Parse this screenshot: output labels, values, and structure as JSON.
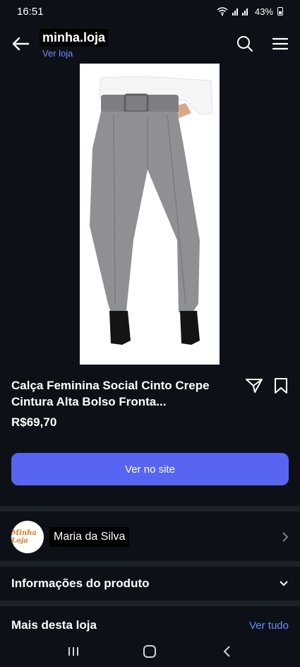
{
  "status": {
    "time": "16:51",
    "battery": "43%"
  },
  "header": {
    "store_name": "minha.loja",
    "store_link": "Ver loja"
  },
  "product": {
    "title": "Calça Feminina Social Cinto Crepe Cintura Alta Bolso Fronta...",
    "price": "R$69,70",
    "cta": "Ver no site"
  },
  "seller": {
    "logo_text": "Minha Loja",
    "name": "Maria da Silva"
  },
  "sections": {
    "product_info": "Informações do produto",
    "more_from_store": "Mais desta loja",
    "see_all": "Ver tudo"
  },
  "colors": {
    "background": "#0d1117",
    "accent": "#5865f2",
    "link": "#6e8bff",
    "divider": "#1c2128"
  }
}
